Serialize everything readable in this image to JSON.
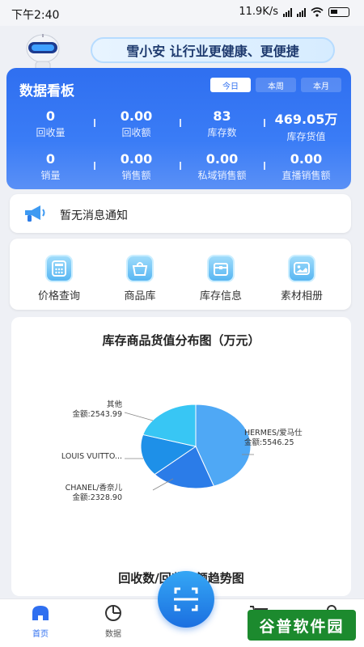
{
  "status_bar": {
    "time": "下午2:40",
    "network_speed": "11.9K/s"
  },
  "banner": {
    "text": "雪小安 让行业更健康、更便捷"
  },
  "dashboard": {
    "title": "数据看板",
    "tabs": [
      {
        "label": "今日",
        "active": true
      },
      {
        "label": "本周",
        "active": false
      },
      {
        "label": "本月",
        "active": false
      }
    ],
    "stats_row1": [
      {
        "value": "0",
        "label": "回收量"
      },
      {
        "value": "0.00",
        "label": "回收额"
      },
      {
        "value": "83",
        "label": "库存数"
      },
      {
        "value": "469.05万",
        "label": "库存货值"
      }
    ],
    "stats_row2": [
      {
        "value": "0",
        "label": "销量"
      },
      {
        "value": "0.00",
        "label": "销售额"
      },
      {
        "value": "0.00",
        "label": "私域销售额"
      },
      {
        "value": "0.00",
        "label": "直播销售额"
      }
    ]
  },
  "notice": {
    "text": "暂无消息通知",
    "icon": "megaphone-icon"
  },
  "quick_actions": [
    {
      "label": "价格查询",
      "icon": "calculator-icon"
    },
    {
      "label": "商品库",
      "icon": "bag-icon"
    },
    {
      "label": "库存信息",
      "icon": "box-icon"
    },
    {
      "label": "素材相册",
      "icon": "photo-icon"
    }
  ],
  "chart_data": {
    "type": "pie",
    "title": "库存商品货值分布图（万元）",
    "slices": [
      {
        "name": "HERMES/爱马仕",
        "label_value": "金额:5546.25",
        "value": 5546.25,
        "color": "#4fa8f5"
      },
      {
        "name": "CHANEL/香奈儿",
        "label_value": "金额:2328.90",
        "value": 2328.9,
        "color": "#2b7ce8"
      },
      {
        "name": "LOUIS VUITTO...",
        "label_value": "",
        "value": 2000,
        "color": "#1e90e8"
      },
      {
        "name": "其他",
        "label_value": "金额:2543.99",
        "value": 2543.99,
        "color": "#38c6f4"
      }
    ]
  },
  "trend": {
    "title": "回收数/回收金额趋势图"
  },
  "bottom_nav": [
    {
      "label": "首页",
      "icon": "home-icon",
      "active": true
    },
    {
      "label": "数据",
      "icon": "pie-chart-icon",
      "active": false
    },
    {
      "label": "",
      "icon": "cart-icon",
      "active": false
    },
    {
      "label": "",
      "icon": "user-icon",
      "active": false
    }
  ],
  "watermark": {
    "text": "谷普软件园"
  }
}
